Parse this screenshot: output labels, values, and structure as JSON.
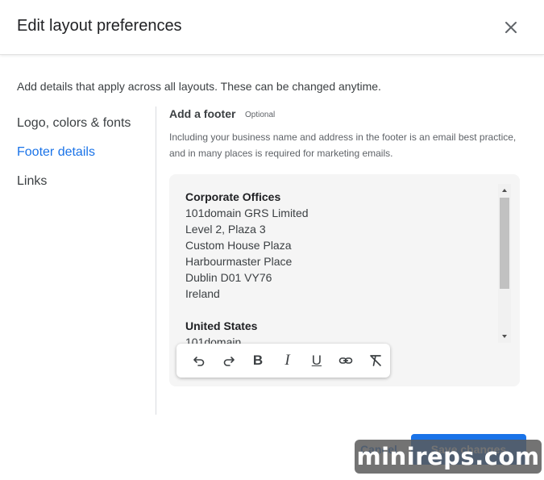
{
  "dialog": {
    "title": "Edit layout preferences",
    "intro": "Add details that apply across all layouts. These can be changed anytime."
  },
  "nav": {
    "items": [
      {
        "label": "Logo, colors & fonts",
        "active": false
      },
      {
        "label": "Footer details",
        "active": true
      },
      {
        "label": "Links",
        "active": false
      }
    ]
  },
  "footer_section": {
    "title": "Add a footer",
    "optional": "Optional",
    "description": "Including your business name and address in the footer is an email best practice, and in many places is required for marketing emails.",
    "editor_lines": [
      "Corporate Offices",
      "101domain GRS Limited",
      "Level 2, Plaza 3",
      "Custom House Plaza",
      "Harbourmaster Place",
      "Dublin D01 VY76",
      "Ireland",
      "",
      "United States",
      "101domain"
    ]
  },
  "toolbar": {
    "icons": [
      "undo-icon",
      "redo-icon",
      "bold-icon",
      "italic-icon",
      "underline-icon",
      "link-icon",
      "clear-format-icon"
    ],
    "bold": "B",
    "italic": "I",
    "underline": "U"
  },
  "actions": {
    "cancel": "Cancel",
    "save": "Save changes"
  },
  "watermark": "minireps.com",
  "colors": {
    "accent": "#1a73e8",
    "text": "#202124",
    "muted": "#5f6368",
    "editor_bg": "#f5f5f5"
  }
}
